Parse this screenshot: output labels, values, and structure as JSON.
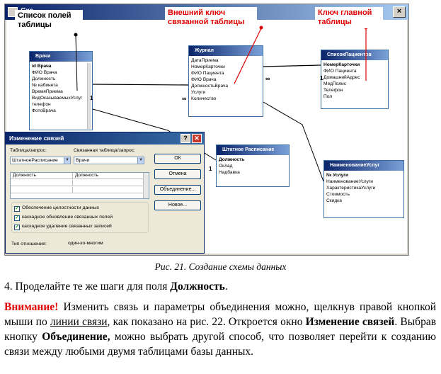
{
  "window": {
    "title": "Схе"
  },
  "callouts": {
    "field_list": "Список полей таблицы",
    "foreign_key": "Внешний ключ связанной таблицы",
    "primary_key": "Ключ главной таблицы"
  },
  "tables": {
    "vrachi": {
      "title": "Врачи",
      "fields": [
        "id Врача",
        "ФИО Врача",
        "Должность",
        "№ кабинета",
        "ВремяПриема",
        "ВидОказываемыхУслуг",
        "телефон",
        "ФотоВрача"
      ],
      "pk_index": 0
    },
    "zhurnal": {
      "title": "Журнал",
      "fields": [
        "ДатаПриема",
        "НомерКарточки",
        "ФИО Пациента",
        "ФИО Врача",
        "ДолжностьВрача",
        "Услуги",
        "Количество"
      ],
      "pk_index": -1
    },
    "patients": {
      "title": "СписокПациентов",
      "fields": [
        "НомерКарточки",
        "ФИО Пациента",
        "ДомашнийАдрес",
        "МедПолис",
        "Телефон",
        "Пол"
      ],
      "pk_index": 0
    },
    "shtat": {
      "title": "Штатное Расписание",
      "fields": [
        "Должность",
        "Оклад",
        "Надбавка"
      ],
      "pk_index": 0
    },
    "services": {
      "title": "НаименованиеУслуг",
      "fields": [
        "№ Услуги",
        "НаименованиеУслуги",
        "ХарактеристикаУслуги",
        "Стоимость",
        "Скидка"
      ],
      "pk_index": 0
    }
  },
  "relation": {
    "one": "1",
    "many": "∞"
  },
  "dialog": {
    "title": "Изменение связей",
    "help_glyph": "?",
    "close_glyph": "✕",
    "table_query_label": "Таблица/запрос:",
    "related_label": "Связанная таблица/запрос:",
    "table_value": "ШтатноеРасписание",
    "related_value": "Врачи",
    "field_left": "Должность",
    "field_right": "Должность",
    "buttons": {
      "ok": "ОК",
      "cancel": "Отмена",
      "join": "Объединение...",
      "new": "Новое..."
    },
    "checks": [
      {
        "label": "Обеспечение целостности данных",
        "checked": true
      },
      {
        "label": "каскадное обновление связанных полей",
        "checked": true
      },
      {
        "label": "каскадное удаление связанных записей",
        "checked": true
      }
    ],
    "relation_type_label": "Тип отношения:",
    "relation_type_value": "один-ко-многим"
  },
  "caption": "Рис. 21. Создание схемы данных",
  "step": {
    "prefix": "4. Проделайте те же шаги для поля ",
    "field": "Должность",
    "suffix": "."
  },
  "note": {
    "warn": "Внимание!",
    "t1": " Изменить связь и параметры объединения можно, щелкнув правой кнопкой мыши по ",
    "link": "линии связи",
    "t2": ", как показано на рис. 22. Откроется окно ",
    "b1": "Изменение связей",
    "t3": ". Выбрав кнопку ",
    "b2": "Объединение,",
    "t4": " можно выбрать другой способ, что позволяет перейти к созданию связи между любыми двумя таблицами базы данных."
  },
  "icons": {
    "check": "check-icon",
    "dropdown": "dropdown-arrow-icon",
    "help": "help-icon",
    "close": "close-icon",
    "key": "key-icon"
  }
}
